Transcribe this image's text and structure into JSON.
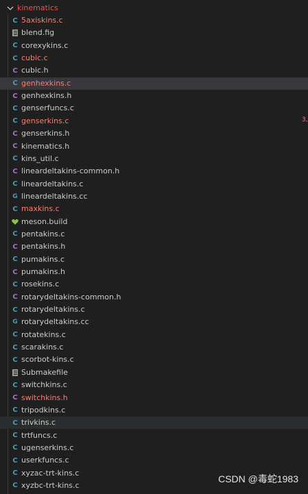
{
  "folder": {
    "name": "kinematics",
    "expanded": true
  },
  "files": [
    {
      "name": "5axiskins.c",
      "type": "c",
      "modified": true
    },
    {
      "name": "blend.fig",
      "type": "txt",
      "modified": false
    },
    {
      "name": "corexykins.c",
      "type": "c",
      "modified": false
    },
    {
      "name": "cubic.c",
      "type": "c",
      "modified": true
    },
    {
      "name": "cubic.h",
      "type": "h",
      "modified": false
    },
    {
      "name": "genhexkins.c",
      "type": "c",
      "modified": true,
      "selected": true
    },
    {
      "name": "genhexkins.h",
      "type": "h",
      "modified": false
    },
    {
      "name": "genserfuncs.c",
      "type": "c",
      "modified": false
    },
    {
      "name": "genserkins.c",
      "type": "c",
      "modified": true,
      "badge": "3,"
    },
    {
      "name": "genserkins.h",
      "type": "h",
      "modified": false
    },
    {
      "name": "kinematics.h",
      "type": "h",
      "modified": false
    },
    {
      "name": "kins_util.c",
      "type": "c",
      "modified": false
    },
    {
      "name": "lineardeltakins-common.h",
      "type": "h",
      "modified": false
    },
    {
      "name": "lineardeltakins.c",
      "type": "c",
      "modified": false
    },
    {
      "name": "lineardeltakins.cc",
      "type": "cc",
      "modified": false
    },
    {
      "name": "maxkins.c",
      "type": "c",
      "modified": true
    },
    {
      "name": "meson.build",
      "type": "build",
      "modified": false
    },
    {
      "name": "pentakins.c",
      "type": "c",
      "modified": false
    },
    {
      "name": "pentakins.h",
      "type": "h",
      "modified": false
    },
    {
      "name": "pumakins.c",
      "type": "c",
      "modified": false
    },
    {
      "name": "pumakins.h",
      "type": "h",
      "modified": false
    },
    {
      "name": "rosekins.c",
      "type": "c",
      "modified": false
    },
    {
      "name": "rotarydeltakins-common.h",
      "type": "h",
      "modified": false
    },
    {
      "name": "rotarydeltakins.c",
      "type": "c",
      "modified": false
    },
    {
      "name": "rotarydeltakins.cc",
      "type": "cc",
      "modified": false
    },
    {
      "name": "rotatekins.c",
      "type": "c",
      "modified": false
    },
    {
      "name": "scarakins.c",
      "type": "c",
      "modified": false
    },
    {
      "name": "scorbot-kins.c",
      "type": "c",
      "modified": false
    },
    {
      "name": "Submakefile",
      "type": "txt",
      "modified": false
    },
    {
      "name": "switchkins.c",
      "type": "c",
      "modified": false
    },
    {
      "name": "switchkins.h",
      "type": "h",
      "modified": true
    },
    {
      "name": "tripodkins.c",
      "type": "c",
      "modified": false
    },
    {
      "name": "trivkins.c",
      "type": "c",
      "modified": false,
      "hover": true
    },
    {
      "name": "trtfuncs.c",
      "type": "c",
      "modified": false
    },
    {
      "name": "ugenserkins.c",
      "type": "c",
      "modified": false
    },
    {
      "name": "userkfuncs.c",
      "type": "c",
      "modified": false
    },
    {
      "name": "xyzac-trt-kins.c",
      "type": "c",
      "modified": false
    },
    {
      "name": "xyzbc-trt-kins.c",
      "type": "c",
      "modified": false
    }
  ],
  "watermark": "CSDN @毒蛇1983",
  "colors": {
    "background": "#1f1f1f",
    "modified_text": "#f97e72",
    "folder_text": "#f14c4c",
    "c_icon": "#519aba",
    "h_icon": "#a074c4",
    "build_icon": "#8dc149"
  }
}
